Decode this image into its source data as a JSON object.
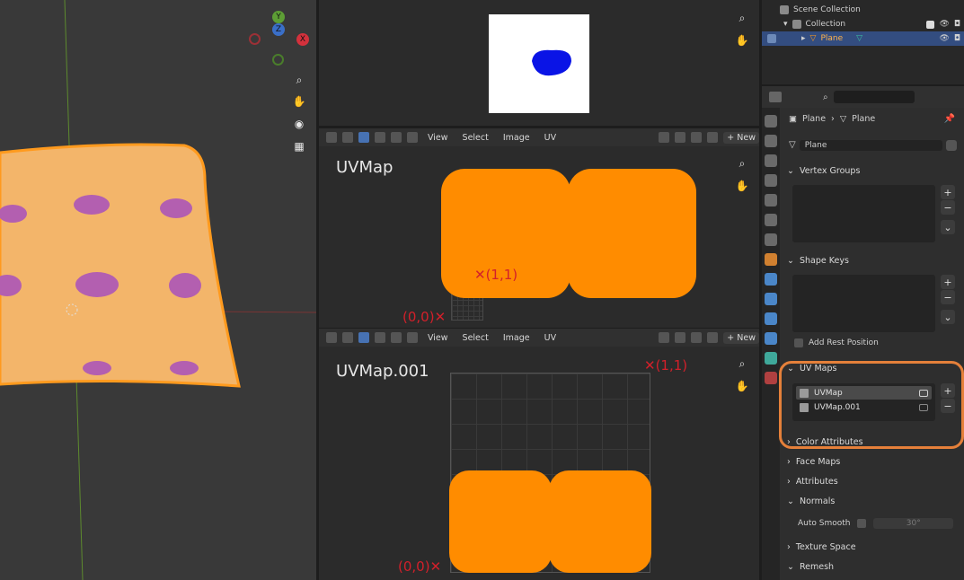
{
  "colors": {
    "accent_orange": "#ff8c00",
    "select_blue": "#334d80",
    "highlight": "#e5803a",
    "marker_red": "#d3202a",
    "uv_island_blue": "#0a14e6"
  },
  "viewport3d": {
    "gizmo_y": "Y",
    "gizmo_z": "Z",
    "gizmo_x": "X"
  },
  "uv_header": {
    "menus": [
      "View",
      "Select",
      "Image",
      "UV"
    ],
    "new_label": "+ New"
  },
  "uv_editor_1": {
    "title": "UVMap",
    "corner_00": "(0,0)",
    "corner_11": "(1,1)"
  },
  "uv_editor_2": {
    "title": "UVMap.001",
    "corner_00": "(0,0)",
    "corner_11": "(1,1)"
  },
  "outliner": {
    "rows": [
      {
        "label": "Scene Collection"
      },
      {
        "label": "Collection"
      },
      {
        "label": "Plane"
      }
    ]
  },
  "properties": {
    "breadcrumb": {
      "object": "Plane",
      "data": "Plane"
    },
    "mesh_name": "Plane",
    "panels": {
      "vertex_groups": "Vertex Groups",
      "shape_keys": "Shape Keys",
      "add_rest_position": "Add Rest Position",
      "uv_maps": "UV Maps",
      "color_attributes": "Color Attributes",
      "face_maps": "Face Maps",
      "attributes": "Attributes",
      "normals": "Normals",
      "auto_smooth": "Auto Smooth",
      "auto_smooth_angle": "30°",
      "texture_space": "Texture Space",
      "remesh": "Remesh"
    },
    "uv_maps_list": [
      "UVMap",
      "UVMap.001"
    ]
  }
}
